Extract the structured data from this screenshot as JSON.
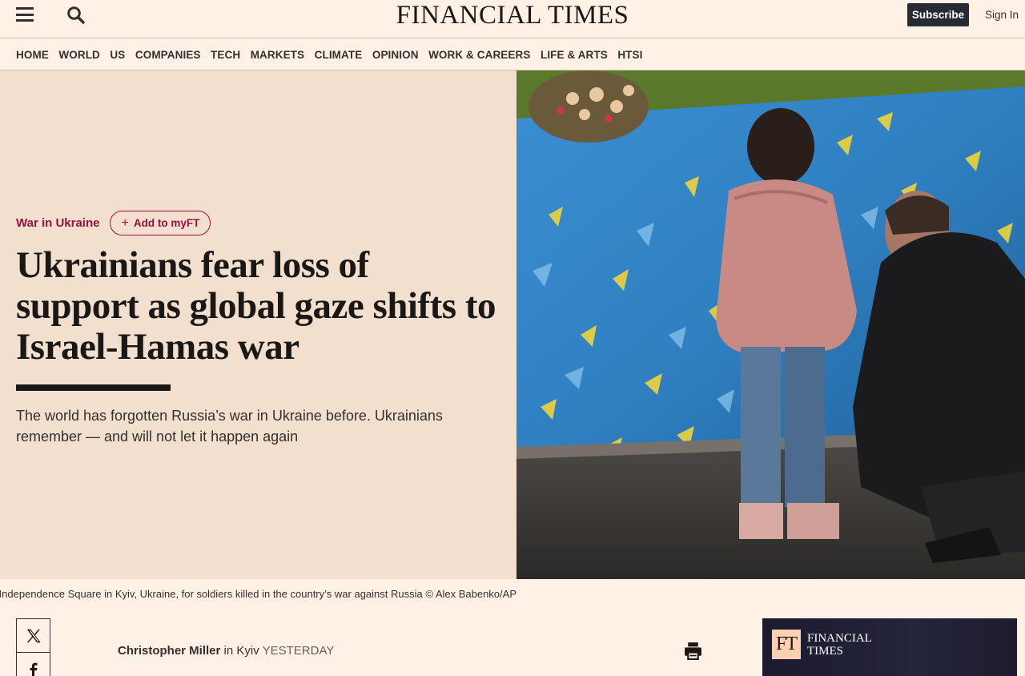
{
  "header": {
    "logo": "FINANCIAL TIMES",
    "subscribe_label": "Subscribe",
    "signin_label": "Sign In"
  },
  "nav": {
    "items": [
      "HOME",
      "WORLD",
      "US",
      "COMPANIES",
      "TECH",
      "MARKETS",
      "CLIMATE",
      "OPINION",
      "WORK & CAREERS",
      "LIFE & ARTS",
      "HTSI"
    ]
  },
  "article": {
    "topic": "War in Ukraine",
    "myft_label": "Add to myFT",
    "headline": "Ukrainians fear loss of support as global gaze shifts to Israel-Hamas war",
    "standfirst": "The world has forgotten Russia’s war in Ukraine before. Ukrainians remember — and will not let it happen again",
    "caption": "Independence Square in Kyiv, Ukraine, for soldiers killed in the country’s war against Russia © Alex Babenko/AP",
    "author": "Christopher Miller",
    "location": "in Kyiv",
    "time": "YESTERDAY"
  },
  "ad": {
    "badge": "FT",
    "name_line1": "FINANCIAL",
    "name_line2": "TIMES"
  },
  "colors": {
    "background": "#fff1e5",
    "hero_panel": "#f2dfce",
    "accent": "#990f3d",
    "subscribe_bg": "#262a33"
  }
}
